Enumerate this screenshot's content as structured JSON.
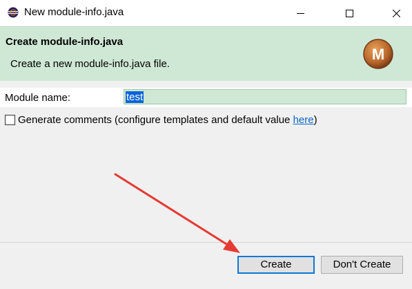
{
  "window": {
    "title": "New module-info.java"
  },
  "header": {
    "title": "Create module-info.java",
    "description": "Create a new module-info.java file.",
    "logo_letter": "M"
  },
  "form": {
    "module_name_label": "Module name:",
    "module_name_value": "test",
    "generate_comments_label": "Generate comments (configure templates and default value ",
    "generate_comments_link": "here",
    "generate_comments_suffix": ")",
    "generate_comments_checked": false
  },
  "buttons": {
    "create": "Create",
    "dont_create": "Don't Create"
  },
  "colors": {
    "header_bg": "#cfe8d5",
    "accent": "#0a78d7",
    "annotation_arrow": "#e53a33"
  },
  "icons": [
    "eclipse-app-icon",
    "minimize-icon",
    "maximize-icon",
    "close-icon",
    "module-logo-icon"
  ]
}
